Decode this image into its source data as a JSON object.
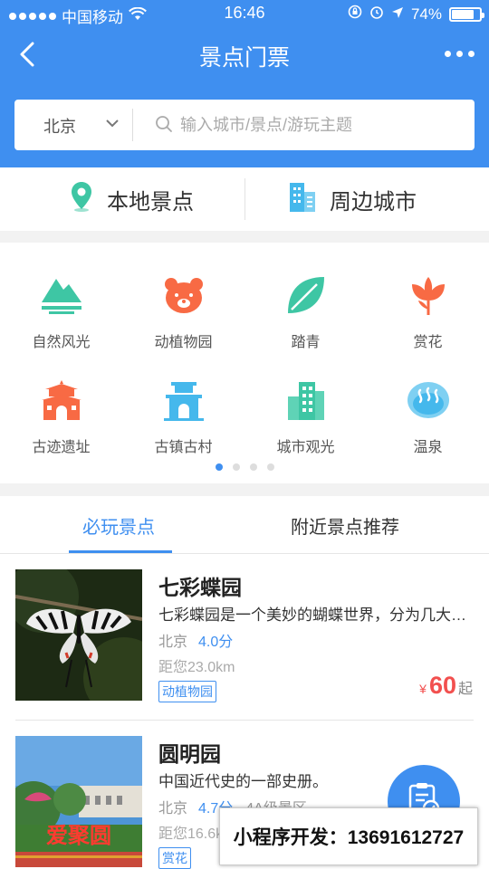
{
  "status_bar": {
    "carrier": "中国移动",
    "time": "16:46",
    "battery": "74%",
    "battery_level": 0.74
  },
  "navbar": {
    "title": "景点门票",
    "back_icon": "chevron-left-icon",
    "more_icon": "more-dots-icon"
  },
  "search": {
    "city": "北京",
    "placeholder": "输入城市/景点/游玩主题"
  },
  "quick_nav": [
    {
      "label": "本地景点",
      "icon": "location-pin-icon"
    },
    {
      "label": "周边城市",
      "icon": "buildings-icon"
    }
  ],
  "categories": [
    {
      "label": "自然风光",
      "icon": "mountain-icon",
      "color": "#3ec6a4"
    },
    {
      "label": "动植物园",
      "icon": "bear-icon",
      "color": "#f86a44"
    },
    {
      "label": "踏青",
      "icon": "leaf-icon",
      "color": "#3ec6a4"
    },
    {
      "label": "赏花",
      "icon": "tulip-icon",
      "color": "#f86a44"
    },
    {
      "label": "古迹遗址",
      "icon": "ancient-gate-icon",
      "color": "#f86a44"
    },
    {
      "label": "古镇古村",
      "icon": "town-gate-icon",
      "color": "#45b8ec"
    },
    {
      "label": "城市观光",
      "icon": "city-buildings-icon",
      "color": "#3ec6a4"
    },
    {
      "label": "温泉",
      "icon": "hot-spring-icon",
      "color": "#45b8ec"
    }
  ],
  "pager": {
    "total": 4,
    "active": 1
  },
  "tabs": [
    {
      "label": "必玩景点",
      "active": true
    },
    {
      "label": "附近景点推荐",
      "active": false
    }
  ],
  "attractions": [
    {
      "name": "七彩蝶园",
      "desc": "七彩蝶园是一个美妙的蝴蝶世界，分为几大展区",
      "city": "北京",
      "score": "4.0分",
      "level": "",
      "distance": "距您23.0km",
      "tag": "动植物园",
      "currency": "¥",
      "price": "60",
      "price_suffix": "起"
    },
    {
      "name": "圆明园",
      "desc": "中国近代史的一部史册。",
      "city": "北京",
      "score": "4.7分",
      "level": "4A级景区",
      "distance": "距您16.6km",
      "tag": "赏花",
      "sign_text": "爱聚圆"
    }
  ],
  "fab_icon": "clipboard-check-icon",
  "promo": "小程序开发：13691612727"
}
